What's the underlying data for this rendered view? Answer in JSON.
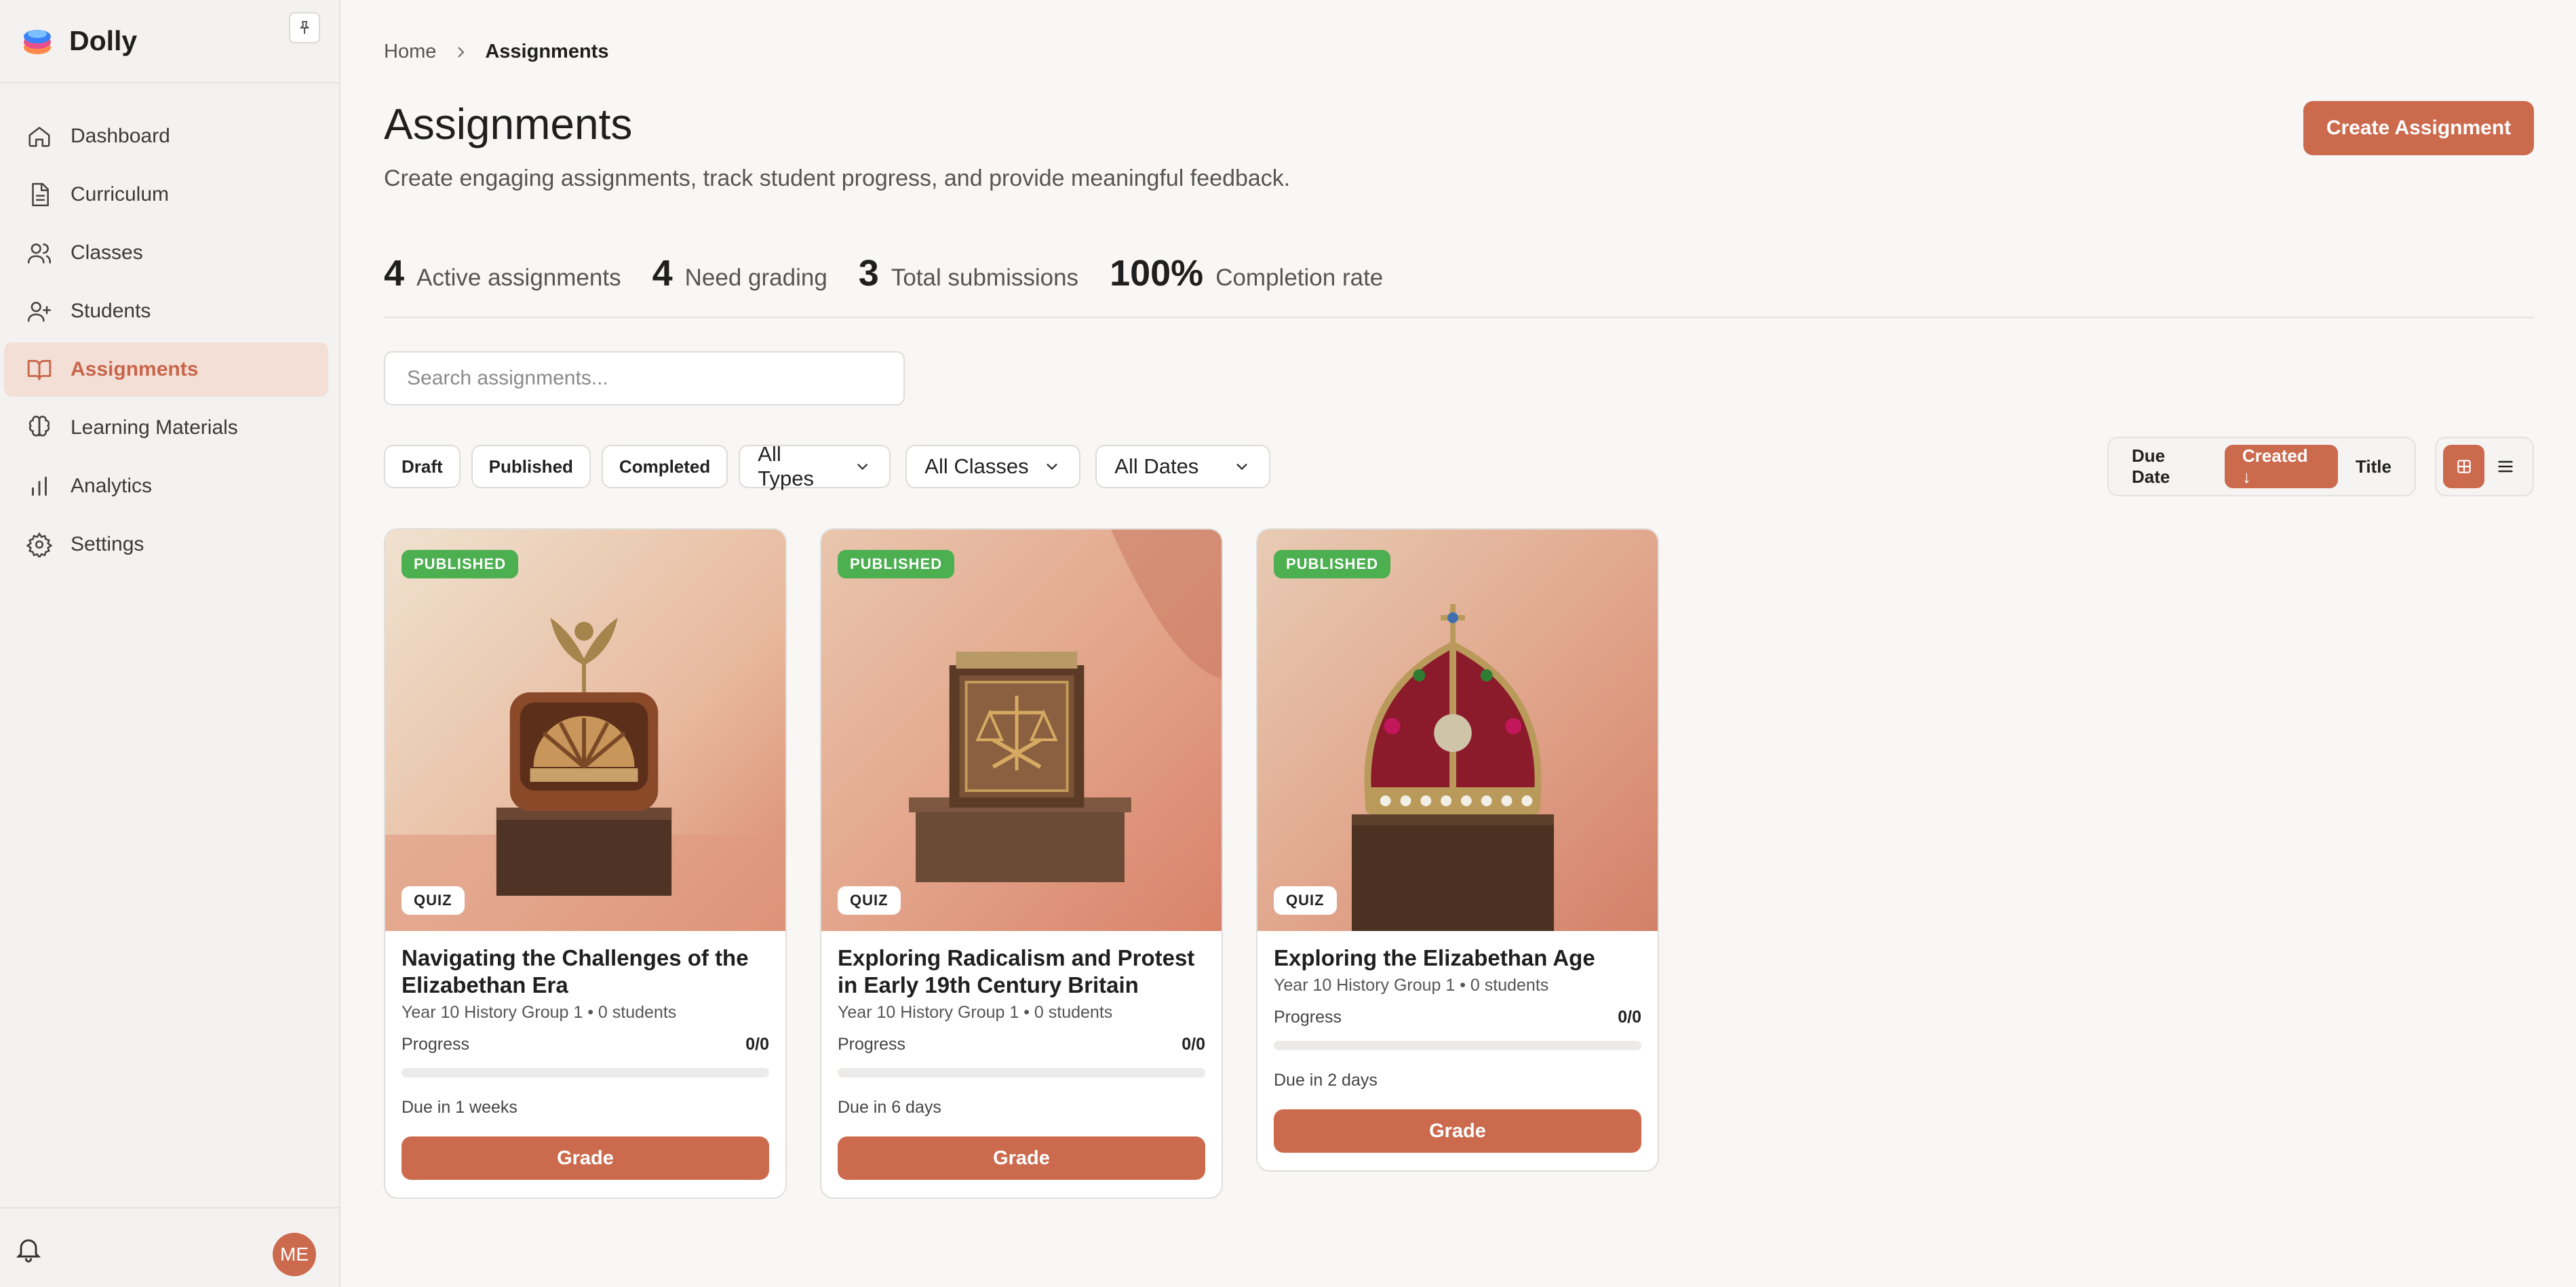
{
  "app": {
    "name": "Dolly"
  },
  "sidebar": {
    "items": [
      {
        "label": "Dashboard",
        "icon": "home-icon"
      },
      {
        "label": "Curriculum",
        "icon": "document-icon"
      },
      {
        "label": "Classes",
        "icon": "users-icon"
      },
      {
        "label": "Students",
        "icon": "user-plus-icon"
      },
      {
        "label": "Assignments",
        "icon": "book-icon",
        "active": true
      },
      {
        "label": "Learning Materials",
        "icon": "brain-icon"
      },
      {
        "label": "Analytics",
        "icon": "bar-chart-icon"
      },
      {
        "label": "Settings",
        "icon": "gear-icon"
      }
    ],
    "user_initials": "ME"
  },
  "breadcrumb": {
    "home": "Home",
    "current": "Assignments"
  },
  "header": {
    "title": "Assignments",
    "subtitle": "Create engaging assignments, track student progress, and provide meaningful feedback.",
    "create_label": "Create Assignment"
  },
  "stats": [
    {
      "value": "4",
      "label": "Active assignments"
    },
    {
      "value": "4",
      "label": "Need grading"
    },
    {
      "value": "3",
      "label": "Total submissions"
    },
    {
      "value": "100%",
      "label": "Completion rate"
    }
  ],
  "search": {
    "placeholder": "Search assignments..."
  },
  "filters": {
    "chips": [
      "Draft",
      "Published",
      "Completed"
    ],
    "dropdowns": [
      "All Types",
      "All Classes",
      "All Dates"
    ]
  },
  "sort": {
    "options": [
      "Due Date",
      "Created ↓",
      "Title"
    ],
    "active": "Created ↓"
  },
  "view": {
    "active": "grid"
  },
  "colors": {
    "accent": "#cc6a4e",
    "published": "#4caf50",
    "active_bg": "#f3dfd6"
  },
  "cards": [
    {
      "status": "PUBLISHED",
      "type": "QUIZ",
      "title": "Navigating the Challenges of the Elizabethan Era",
      "meta": "Year 10 History Group 1 • 0 students",
      "progress_label": "Progress",
      "progress_value": "0/0",
      "progress_fraction": 0,
      "due": "Due in 1 weeks",
      "grade_label": "Grade",
      "image": "radio-on-pedestal"
    },
    {
      "status": "PUBLISHED",
      "type": "QUIZ",
      "title": "Exploring Radicalism and Protest in Early 19th Century Britain",
      "meta": "Year 10 History Group 1 • 0 students",
      "progress_label": "Progress",
      "progress_value": "0/0",
      "progress_fraction": 0,
      "due": "Due in 6 days",
      "grade_label": "Grade",
      "image": "scales-box-on-pedestal"
    },
    {
      "status": "PUBLISHED",
      "type": "QUIZ",
      "title": "Exploring the Elizabethan Age",
      "meta": "Year 10 History Group 1 • 0 students",
      "progress_label": "Progress",
      "progress_value": "0/0",
      "progress_fraction": 0,
      "due": "Due in 2 days",
      "grade_label": "Grade",
      "image": "crown-on-pedestal"
    }
  ]
}
